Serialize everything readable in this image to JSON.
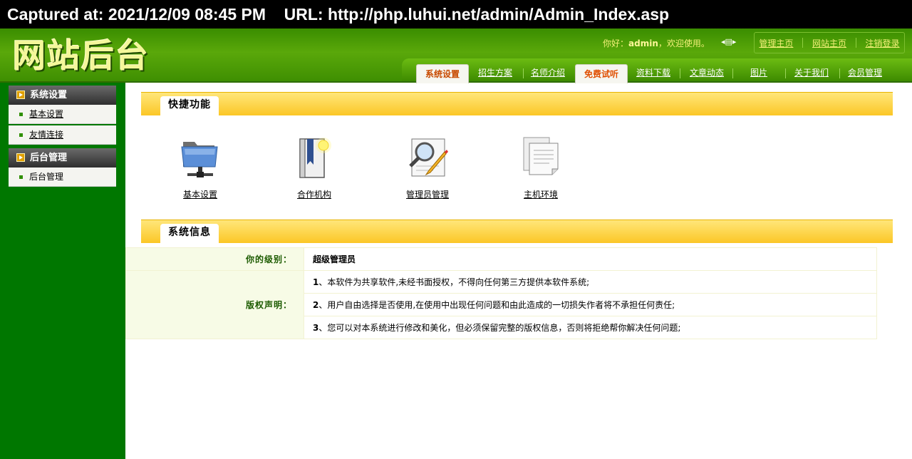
{
  "capture": {
    "text": "Captured at: 2021/12/09 08:45 PM    URL: http://php.luhui.net/admin/Admin_Index.asp"
  },
  "header": {
    "logo": "网站后台",
    "welcome_prefix": "你好：",
    "username": "admin",
    "welcome_suffix": "，欢迎使用。",
    "toplinks": [
      "管理主页",
      "网站主页",
      "注销登录"
    ]
  },
  "nav": {
    "tabs": [
      "系统设置",
      "招生方案",
      "名师介绍",
      "免费试听",
      "资料下载",
      "文章动态",
      "图片",
      "关于我们",
      "会员管理"
    ],
    "active": [
      "系统设置",
      "免费试听"
    ]
  },
  "sidebar": {
    "groups": [
      {
        "title": "系统设置",
        "items": [
          "基本设置",
          "友情连接"
        ]
      },
      {
        "title": "后台管理",
        "items": [
          "后台管理"
        ]
      }
    ]
  },
  "quick": {
    "title": "快捷功能",
    "items": [
      {
        "label": "基本设置",
        "icon": "network-folder-icon"
      },
      {
        "label": "合作机构",
        "icon": "book-icon"
      },
      {
        "label": "管理员管理",
        "icon": "search-edit-icon"
      },
      {
        "label": "主机环境",
        "icon": "documents-icon"
      }
    ]
  },
  "system_info": {
    "title": "系统信息",
    "level_label": "你的级别：",
    "level_value": "超级管理员",
    "copyright_label": "版权声明：",
    "copyright_lines": [
      {
        "num": "1",
        "text": "、本软件为共享软件,未经书面授权，不得向任何第三方提供本软件系统;"
      },
      {
        "num": "2",
        "text": "、用户自由选择是否使用,在使用中出现任何问题和由此造成的一切损失作者将不承担任何责任;"
      },
      {
        "num": "3",
        "text": "、您可以对本系统进行修改和美化，但必须保留完整的版权信息，否则将拒绝帮你解决任何问题;"
      }
    ]
  },
  "colors": {
    "sidebar": "#007700",
    "header": "#4a9a05",
    "section": "#fbc726",
    "accent": "#e04e00"
  }
}
